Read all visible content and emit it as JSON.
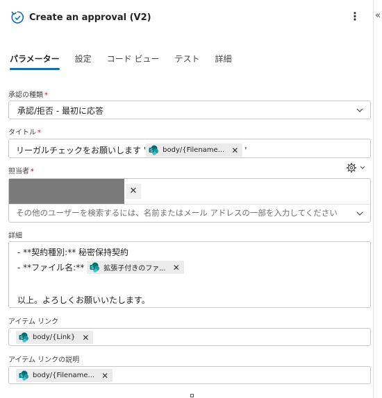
{
  "header": {
    "title": "Create an approval (V2)"
  },
  "tabs": [
    {
      "label": "パラメーター"
    },
    {
      "label": "設定"
    },
    {
      "label": "コード ビュー"
    },
    {
      "label": "テスト"
    },
    {
      "label": "詳細"
    }
  ],
  "fields": {
    "approval_type": {
      "label": "承認の種類",
      "required_mark": "*",
      "value": "承認/拒否 - 最初に応答"
    },
    "title": {
      "label": "タイトル",
      "required_mark": "*",
      "prefix": "リーガルチェックをお願いします '",
      "token": "body/{Filename...",
      "suffix": "'"
    },
    "assigned_to": {
      "label": "担当者",
      "required_mark": "*",
      "placeholder": "その他のユーザーを検索するには、名前またはメール アドレスの一部を入力してください"
    },
    "details": {
      "label": "詳細",
      "line1": "- **契約種別:** 秘密保持契約",
      "line2_prefix": "- **ファイル名:**",
      "line2_token": "拡張子付きのファ...",
      "line3": "以上。よろしくお願いいたします。"
    },
    "item_link": {
      "label": "アイテム リンク",
      "token": "body/{Link}"
    },
    "item_link_desc": {
      "label": "アイテム リンクの説明",
      "token": "body/{Filename..."
    }
  },
  "colors": {
    "accent": "#0f6cbd",
    "required": "#c50f1f",
    "sharepoint": "#038387"
  },
  "icons": {
    "header": "approval-refresh-icon",
    "token": "sharepoint-icon",
    "remove": "close-icon",
    "settings": "gear-icon",
    "more": "more-vertical-icon",
    "collapse": "collapse-panel-icon"
  }
}
